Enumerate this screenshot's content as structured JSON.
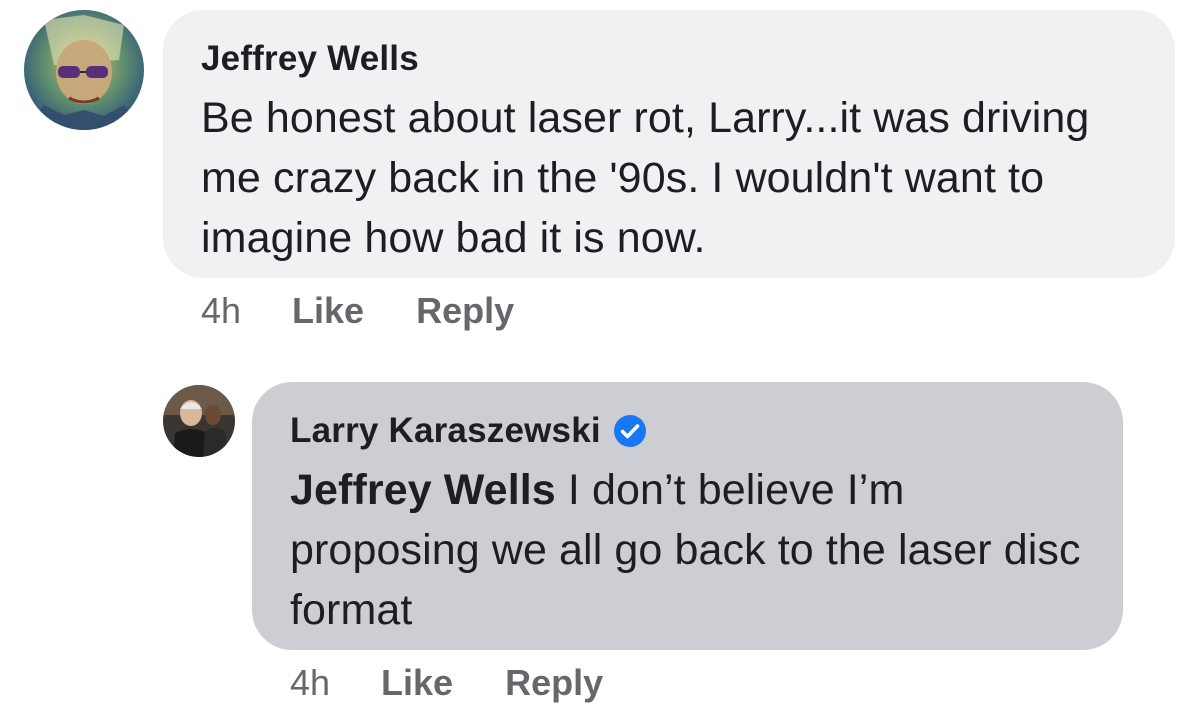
{
  "comments": [
    {
      "author": "Jeffrey Wells",
      "text": "Be honest about laser rot, Larry...it was driving me crazy back in the '90s.  I wouldn't want to imagine how bad it is now.",
      "time": "4h",
      "like_label": "Like",
      "reply_label": "Reply"
    },
    {
      "author": "Larry Karaszewski",
      "verified": true,
      "mention": "Jeffrey Wells",
      "text": " I don’t believe I’m proposing we all go back to the laser disc format",
      "time": "4h",
      "like_label": "Like",
      "reply_label": "Reply"
    }
  ],
  "colors": {
    "bubble_primary": "#f0f1f3",
    "bubble_reply": "#cdced3",
    "meta_text": "#65676b",
    "verified_blue": "#1877f2"
  },
  "icons": {
    "verified": "verified-badge-icon"
  }
}
